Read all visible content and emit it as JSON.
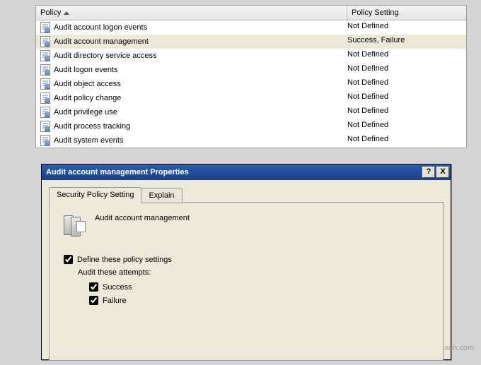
{
  "table": {
    "header_policy": "Policy",
    "header_setting": "Policy Setting",
    "rows": [
      {
        "name": "Audit account logon events",
        "setting": "Not Defined",
        "selected": false
      },
      {
        "name": "Audit account management",
        "setting": "Success, Failure",
        "selected": true
      },
      {
        "name": "Audit directory service access",
        "setting": "Not Defined",
        "selected": false
      },
      {
        "name": "Audit logon events",
        "setting": "Not Defined",
        "selected": false
      },
      {
        "name": "Audit object access",
        "setting": "Not Defined",
        "selected": false
      },
      {
        "name": "Audit policy change",
        "setting": "Not Defined",
        "selected": false
      },
      {
        "name": "Audit privilege use",
        "setting": "Not Defined",
        "selected": false
      },
      {
        "name": "Audit process tracking",
        "setting": "Not Defined",
        "selected": false
      },
      {
        "name": "Audit system events",
        "setting": "Not Defined",
        "selected": false
      }
    ]
  },
  "dialog": {
    "title": "Audit account management Properties",
    "help_label": "?",
    "close_label": "X",
    "tabs": {
      "active": "Security Policy Setting",
      "inactive": "Explain"
    },
    "policy_name": "Audit account management",
    "define_label": "Define these policy settings",
    "define_checked": true,
    "attempts_label": "Audit these attempts:",
    "success_label": "Success",
    "success_checked": true,
    "failure_label": "Failure",
    "failure_checked": true
  },
  "watermark": "wsxdn.com"
}
